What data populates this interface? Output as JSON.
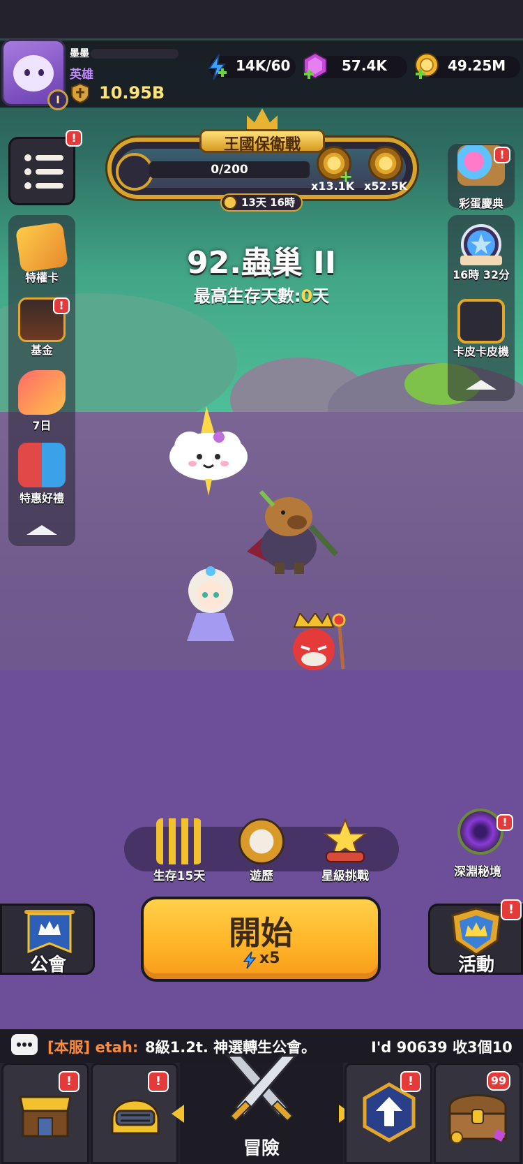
{
  "player": {
    "name": "墨墨",
    "title": "英雄",
    "level_badge": "I",
    "power": "10.95B"
  },
  "resources": {
    "energy": "14K/60",
    "gems": "57.4K",
    "gold": "49.25M"
  },
  "event_banner": {
    "title": "王國保衛戰",
    "progress_text": "0/200",
    "progress": 0,
    "reward_1": "x13.1K",
    "reward_2": "x52.5K",
    "timer": "13天 16時"
  },
  "stage": {
    "name": "92.蟲巢 II",
    "best_days_label": "最高生存天數:",
    "best_days_value": "0",
    "best_days_unit": "天"
  },
  "left_menu": {
    "items": [
      {
        "label": "特權卡",
        "icon": "privilege-card-icon"
      },
      {
        "label": "基金",
        "icon": "fund-icon"
      },
      {
        "label": "7日",
        "icon": "seven-day-icon"
      },
      {
        "label": "特惠好禮",
        "icon": "gift-box-icon"
      }
    ]
  },
  "right_menu": {
    "top_label": "彩蛋慶典",
    "items": [
      {
        "label": "16時 32分",
        "icon": "star-badge-icon"
      },
      {
        "label": "卡皮卡皮機",
        "icon": "capsule-machine-icon"
      }
    ]
  },
  "actions": {
    "survive": "生存15天",
    "travel": "遊歷",
    "star_challenge": "星級挑戰",
    "abyss": "深淵秘境"
  },
  "start_button": {
    "label": "開始",
    "cost": "x5"
  },
  "guild_label": "公會",
  "event_label": "活動",
  "chat": {
    "tag": "[本服] etah:",
    "message": "8級1.2t.  神選轉生公會。",
    "right_text": "I'd 90639 收3個10"
  },
  "nav": {
    "center_label": "冒險",
    "chest_count": "99"
  },
  "badges": {
    "mark": "!"
  },
  "colors": {
    "accent_gold": "#d8a52a",
    "start_orange": "#ffb528",
    "badge_red": "#e53a3a",
    "chat_tag": "#ff8a3a"
  }
}
